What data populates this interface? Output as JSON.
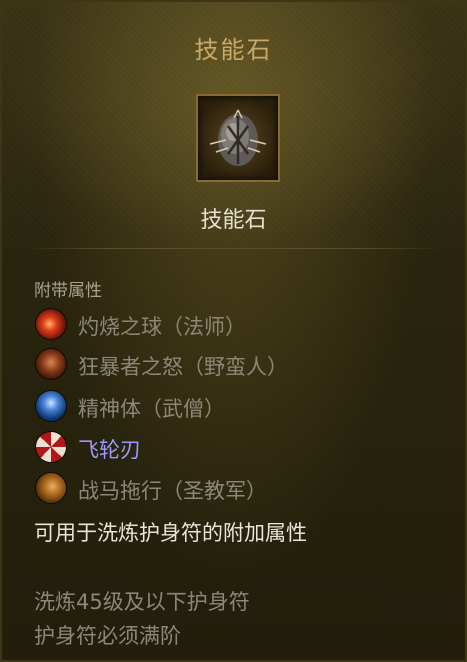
{
  "tooltip": {
    "title": "技能石",
    "item_name": "技能石",
    "icon": "skill-stone-icon",
    "section_label": "附带属性",
    "affixes": [
      {
        "label": "灼烧之球（法师）",
        "icon": "fireball-icon",
        "active": false
      },
      {
        "label": "狂暴者之怒（野蛮人）",
        "icon": "berserker-mask-icon",
        "active": false
      },
      {
        "label": "精神体（武僧）",
        "icon": "spirit-form-icon",
        "active": false
      },
      {
        "label": "飞轮刃",
        "icon": "spinning-blade-icon",
        "active": true
      },
      {
        "label": "战马拖行（圣教军）",
        "icon": "warhorse-icon",
        "active": false
      }
    ],
    "description": "可用于洗炼护身符的附加属性",
    "requirement_level": "洗炼45级及以下护身符",
    "requirement_rank": "护身符必须满阶"
  },
  "colors": {
    "title": "#c8a96a",
    "item_name": "#e6e0d0",
    "active_affix": "#9d98ff",
    "inactive_affix": "#8c8778"
  }
}
